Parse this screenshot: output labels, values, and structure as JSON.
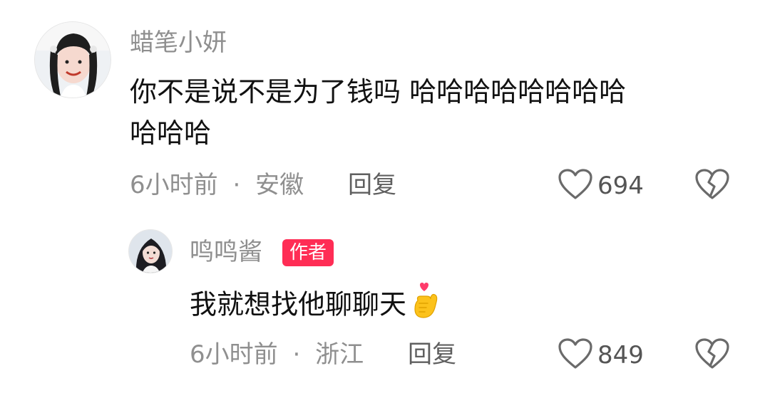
{
  "comments": [
    {
      "username": "蜡笔小妍",
      "text_line1": "你不是说不是为了钱吗 哈哈哈哈哈哈哈哈",
      "text_line2": "哈哈哈",
      "time": "6小时前",
      "dot": "·",
      "location": "安徽",
      "reply_label": "回复",
      "likes": "694"
    }
  ],
  "replies": [
    {
      "username": "鸣鸣酱",
      "badge": "作者",
      "text": "我就想找他聊聊天",
      "time": "6小时前",
      "dot": "·",
      "location": "浙江",
      "reply_label": "回复",
      "likes": "849"
    }
  ],
  "colors": {
    "badge": "#ff2d55",
    "meta_text": "#8f8f8f",
    "body_text": "#111111"
  },
  "icons": [
    "heart-icon",
    "broken-heart-icon",
    "heart-hands-emoji"
  ]
}
